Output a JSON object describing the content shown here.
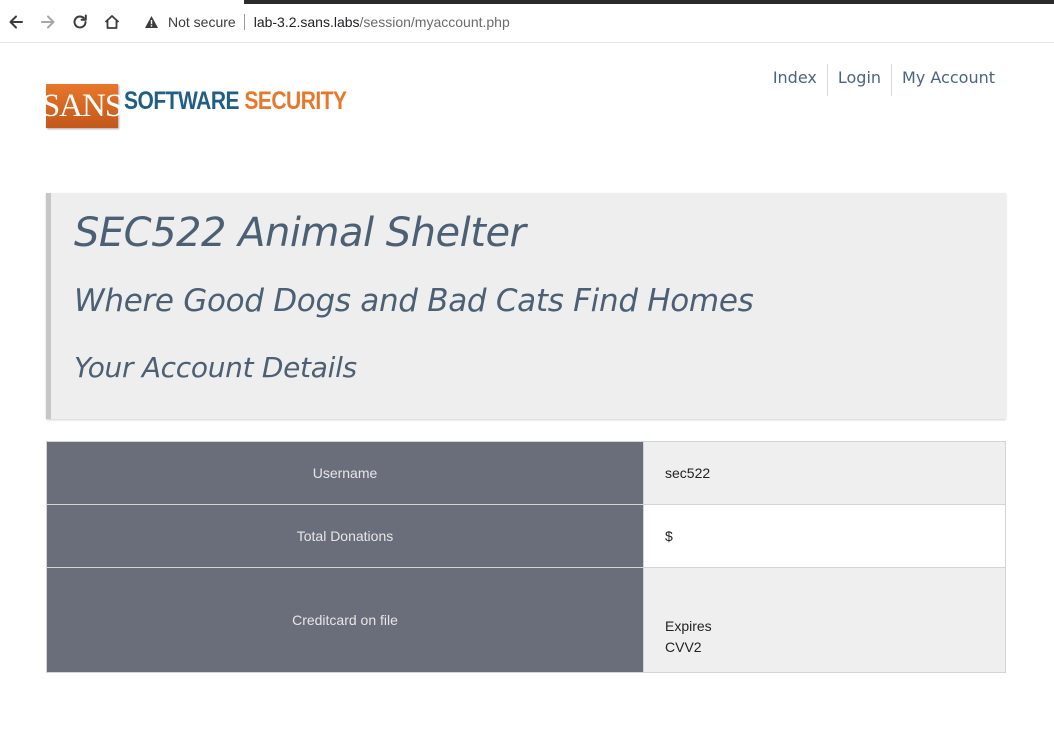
{
  "browser": {
    "security_label": "Not secure",
    "url_host": "lab-3.2.sans.labs",
    "url_path": "/session/myaccount.php"
  },
  "logo": {
    "sans": "SANS",
    "word1": "SOFTWARE",
    "word2": "SECURITY"
  },
  "nav": {
    "items": [
      "Index",
      "Login",
      "My Account"
    ]
  },
  "hero": {
    "title": "SEC522 Animal Shelter",
    "subtitle": "Where Good Dogs and Bad Cats Find Homes",
    "section": "Your Account Details"
  },
  "account": {
    "rows": [
      {
        "label": "Username",
        "value": "sec522"
      },
      {
        "label": "Total Donations",
        "value": "$"
      },
      {
        "label": "Creditcard on file",
        "lines": [
          "Expires",
          "CVV2"
        ]
      }
    ]
  },
  "colors": {
    "label_cell": "#696e7a",
    "heading_text": "#4b6075",
    "brand_orange": "#e8772a",
    "brand_blue": "#1f5f86"
  }
}
